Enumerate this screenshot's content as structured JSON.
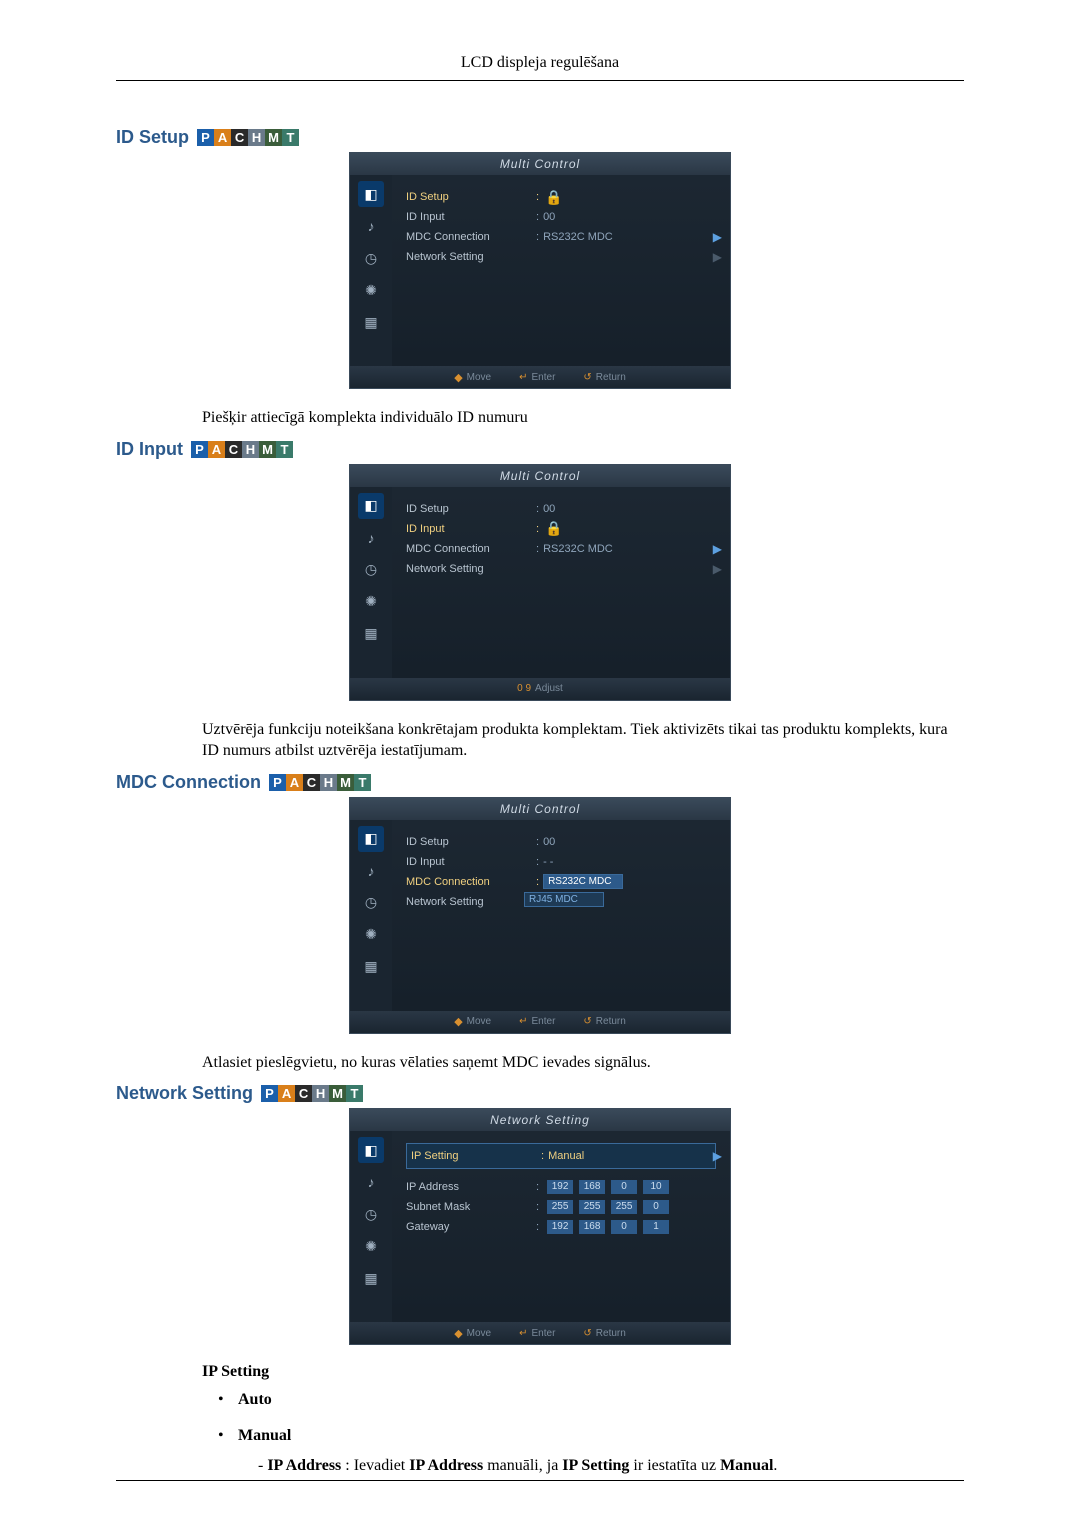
{
  "header": {
    "title": "LCD displeja regulēšana"
  },
  "badges": [
    "P",
    "A",
    "C",
    "H",
    "M",
    "T"
  ],
  "sections": {
    "s1": {
      "title": "ID Setup",
      "osd": {
        "title": "Multi Control",
        "rows": {
          "r0": {
            "label": "ID Setup",
            "val": ""
          },
          "r1": {
            "label": "ID Input",
            "val": "00"
          },
          "r2": {
            "label": "MDC Connection",
            "val": "RS232C MDC"
          },
          "r3": {
            "label": "Network Setting",
            "val": ""
          }
        },
        "foot": {
          "move": "Move",
          "enter": "Enter",
          "ret": "Return"
        }
      },
      "desc": "Piešķir attiecīgā komplekta individuālo ID numuru"
    },
    "s2": {
      "title": "ID Input",
      "osd": {
        "title": "Multi Control",
        "rows": {
          "r0": {
            "label": "ID Setup",
            "val": "00"
          },
          "r1": {
            "label": "ID Input",
            "val": ""
          },
          "r2": {
            "label": "MDC Connection",
            "val": "RS232C MDC"
          },
          "r3": {
            "label": "Network Setting",
            "val": ""
          }
        },
        "foot": {
          "nums": "0  9",
          "adj": "Adjust"
        }
      },
      "desc": "Uztvērēja funkciju noteikšana konkrētajam produkta komplektam. Tiek aktivizēts tikai tas produktu komplekts, kura ID numurs atbilst uztvērēja iestatījumam."
    },
    "s3": {
      "title": "MDC Connection",
      "osd": {
        "title": "Multi Control",
        "rows": {
          "r0": {
            "label": "ID Setup",
            "val": "00"
          },
          "r1": {
            "label": "ID Input",
            "val": "- -"
          },
          "r2": {
            "label": "MDC Connection",
            "val": ""
          },
          "r3": {
            "label": "Network Setting",
            "val": ""
          }
        },
        "dd": {
          "opt0": "RS232C MDC",
          "opt1": "RJ45 MDC"
        },
        "foot": {
          "move": "Move",
          "enter": "Enter",
          "ret": "Return"
        }
      },
      "desc": "Atlasiet pieslēgvietu, no kuras vēlaties saņemt MDC ievades signālus."
    },
    "s4": {
      "title": "Network Setting",
      "osd": {
        "title": "Network Setting",
        "rows": {
          "r0": {
            "label": "IP Setting",
            "val": "Manual"
          },
          "r1": {
            "label": "IP Address",
            "ip": [
              "192",
              "168",
              "0",
              "10"
            ]
          },
          "r2": {
            "label": "Subnet Mask",
            "ip": [
              "255",
              "255",
              "255",
              "0"
            ]
          },
          "r3": {
            "label": "Gateway",
            "ip": [
              "192",
              "168",
              "0",
              "1"
            ]
          }
        },
        "foot": {
          "move": "Move",
          "enter": "Enter",
          "ret": "Return"
        }
      },
      "sub": {
        "h": "IP Setting",
        "b1": "Auto",
        "b2": "Manual",
        "note_prefix": "- ",
        "note_b1": "IP Address",
        "note_t1": " : Ievadiet ",
        "note_b2": "IP Address",
        "note_t2": " manuāli, ja ",
        "note_b3": "IP Setting",
        "note_t3": " ir iestatīta uz ",
        "note_b4": "Manual",
        "note_t4": "."
      }
    }
  }
}
